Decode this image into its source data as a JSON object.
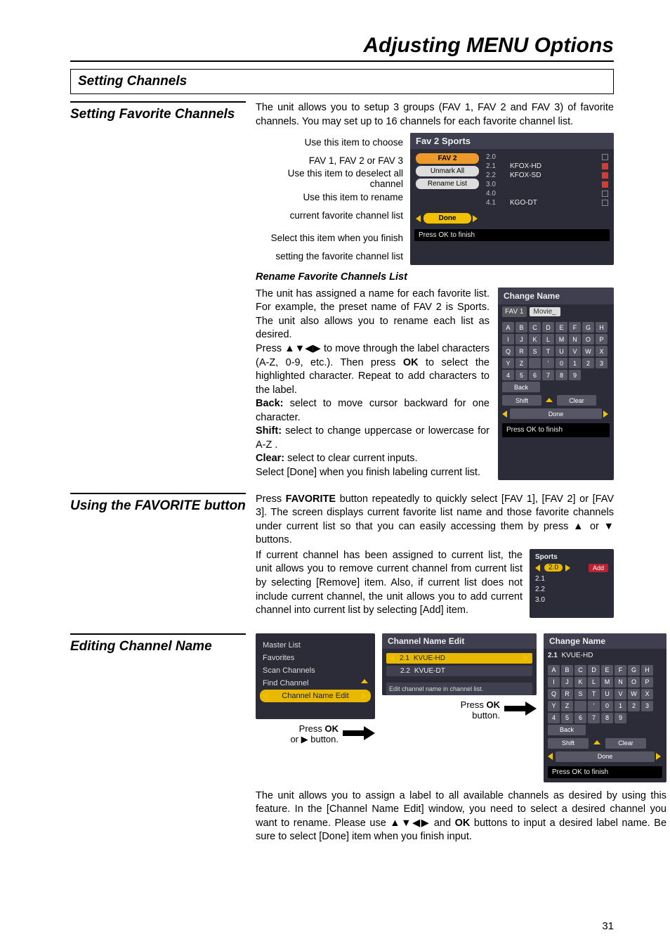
{
  "page": {
    "title": "Adjusting MENU Options",
    "section": "Setting Channels",
    "page_number": "31"
  },
  "favorite": {
    "heading": "Setting Favorite Channels",
    "intro": "The unit allows you to setup 3 groups (FAV 1, FAV 2 and FAV 3) of favorite channels. You may set up to 16 channels for each favorite channel list.",
    "h1a": "Use this item to choose",
    "h1b": "FAV 1, FAV 2 or FAV 3",
    "h2": "Use this item to deselect all channel",
    "h3a": "Use this item to rename",
    "h3b": "current favorite channel list",
    "h4a": "Select this item when you finish",
    "h4b": "setting the favorite channel list",
    "screen": {
      "title": "Fav 2 Sports",
      "btn1": "FAV 2",
      "btn2": "Unmark All",
      "btn3": "Rename List",
      "done": "Done",
      "ch": [
        {
          "n": "2.0",
          "name": "",
          "on": false
        },
        {
          "n": "2.1",
          "name": "KFOX-HD",
          "on": true
        },
        {
          "n": "2.2",
          "name": "KFOX-SD",
          "on": true
        },
        {
          "n": "3.0",
          "name": "",
          "on": true
        },
        {
          "n": "4.0",
          "name": "",
          "on": false
        },
        {
          "n": "4.1",
          "name": "KGO-DT",
          "on": false
        }
      ],
      "footer": "Press OK to finish"
    },
    "rename": {
      "heading": "Rename Favorite Channels List",
      "p1": "The unit has assigned a name for each favorite list. For example, the preset name of FAV 2 is Sports. The unit also allows you to rename each list as desired.",
      "p2a": "Press ▲▼◀▶ to move through the label characters (A-Z, 0-9, etc.). Then press ",
      "p2b": " to select the highlighted character. Repeat to add characters to the label.",
      "back": "Back: ",
      "backt": "select to move cursor backward for one character.",
      "shift": "Shift: ",
      "shiftt": "select to change uppercase or lowercase for A-Z .",
      "clear": "Clear: ",
      "cleart": "select to clear current inputs.",
      "p3": "Select [Done] when you finish labeling current list.",
      "ok": "OK"
    },
    "change": {
      "title": "Change Name",
      "label": "FAV 1",
      "value": "Movie_",
      "back": "Back",
      "shift": "Shift",
      "clear": "Clear",
      "done": "Done",
      "footer": "Press OK to finish"
    }
  },
  "using": {
    "heading": "Using the FAVORITE button",
    "p1a": "Press ",
    "p1b": "FAVORITE",
    "p1c": " button repeatedly to quickly select [FAV 1], [FAV 2] or [FAV 3]. The screen displays current favorite list name and those favorite channels under current list so that you can easily accessing them by press ▲ or ▼ buttons.",
    "p2": "If current channel has been assigned to current list, the unit allows you to remove current channel from current list by selecting [Remove] item. Also, if current list does not include current channel, the unit allows you to add current channel into current list by selecting [Add] item.",
    "pop": {
      "title": "Sports",
      "sel": "2.0",
      "r": [
        "2.1",
        "2.2",
        "3.0"
      ],
      "add": "Add"
    }
  },
  "edit": {
    "heading": "Editing Channel Name",
    "menu": [
      "Master List",
      "Favorites",
      "Scan Channels",
      "Find Channel",
      "Channel Name Edit"
    ],
    "press_ok_or": "Press ",
    "ok": "OK",
    "or_btn": "or ▶ button.",
    "press_ok_btn": "Press ",
    "btn_word": "button.",
    "cne": {
      "title": "Channel Name Edit",
      "r": [
        {
          "n": "2.1",
          "name": "KVUE-HD"
        },
        {
          "n": "2.2",
          "name": "KVUE-DT"
        }
      ],
      "footer": "Edit channel name in channel list."
    },
    "change": {
      "title": "Change Name",
      "sel": "2.1",
      "selname": "KVUE-HD",
      "back": "Back",
      "shift": "Shift",
      "clear": "Clear",
      "done": "Done",
      "footer": "Press OK to finish"
    },
    "p": "The unit allows you to assign a label to all available channels as desired by using this feature. In the [Channel Name Edit] window, you need to select a desired channel you want to rename. Please use ▲▼◀▶ and ",
    "p2": " buttons to input a desired label name. Be sure to select [Done] item when you finish input."
  }
}
